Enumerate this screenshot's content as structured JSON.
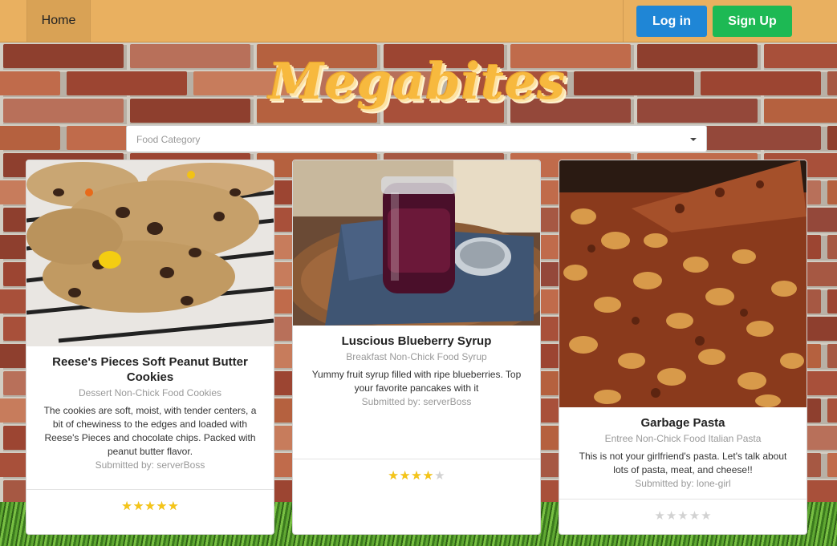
{
  "navbar": {
    "home_label": "Home",
    "login_label": "Log in",
    "signup_label": "Sign Up"
  },
  "brand": {
    "logo_text": "Megabites"
  },
  "filter": {
    "category_placeholder": "Food Category"
  },
  "colors": {
    "navbar": "#e9b060",
    "login": "#1f86d6",
    "signup": "#1db954",
    "star_on": "#f5c518",
    "star_off": "#d2d2d2"
  },
  "cards": [
    {
      "title": "Reese's Pieces Soft Peanut Butter Cookies",
      "category": "Dessert Non-Chick Food Cookies",
      "description": "The cookies are soft, moist, with tender centers, a bit of chewiness to the edges and loaded with Reese's Pieces and chocolate chips. Packed with peanut butter flavor.",
      "submitted_by": "Submitted by: serverBoss",
      "rating": 5,
      "image": "cookie-photo"
    },
    {
      "title": "Luscious Blueberry Syrup",
      "category": "Breakfast Non-Chick Food Syrup",
      "description": "Yummy fruit syrup filled with ripe blueberries. Top your favorite pancakes with it",
      "submitted_by": "Submitted by: serverBoss",
      "rating": 4,
      "image": "syrup-jar-photo"
    },
    {
      "title": "Garbage Pasta",
      "category": "Entree Non-Chick Food Italian Pasta",
      "description": "This is not your girlfriend's pasta. Let's talk about lots of pasta, meat, and cheese!!",
      "submitted_by": "Submitted by: lone-girl",
      "rating": 0,
      "image": "pasta-photo"
    }
  ]
}
